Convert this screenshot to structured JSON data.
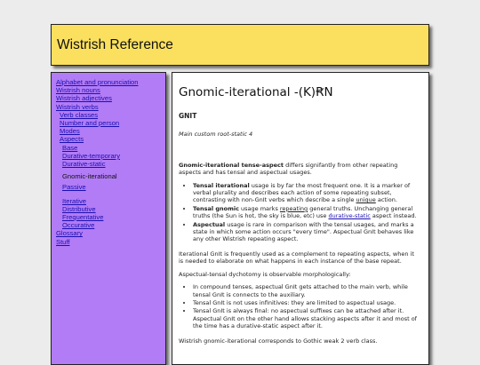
{
  "header": {
    "title": "Wistrish Reference"
  },
  "nav": {
    "alphabet": "Alphabet and pronunciation",
    "nouns": "Wistrish nouns",
    "adjectives": "Wistrish adjectives",
    "verbs": "Wistrish verbs",
    "verb_classes": "Verb classes",
    "number_person": "Number and person",
    "modes": "Modes",
    "aspects": "Aspects",
    "base": "Base",
    "durative_temporary": "Durative-temporary",
    "durative_static": "Durative-static",
    "gnomic_iterational": "Gnomic-iterational",
    "passive": "Passive",
    "iterative": "Iterative",
    "distributive": "Distributive",
    "frequentative": "Frequentative",
    "occurative": "Occurative",
    "glossary": "Glossary",
    "stuff": "Stuff"
  },
  "main": {
    "title": "Gnomic-iterational -(K)ꞦN",
    "word": "GNIT",
    "subtitle": "Main custom root-static 4",
    "intro_bold": "Gnomic-iterational tense-aspect",
    "intro_rest": " differs signifantly from other repeating aspects and has tensal and aspectual usages.",
    "b1_term": "Tensal iterational",
    "b1_a": " usage is by far the most frequent one. It is a marker of verbal plurality and describes each action of some repeating subset, contrasting with non-GnIt verbs which describe a single ",
    "b1_u": "unique",
    "b1_b": " action.",
    "b2_term": "Tensal gnomic",
    "b2_a": " usage marks ",
    "b2_u": "repeating",
    "b2_b": " general truths. Unchanging general truths (the Sun is hot, the sky is blue, etc) use ",
    "b2_link": "durative-static",
    "b2_c": " aspect instead.",
    "b3_term": "Aspectual",
    "b3_rest": " usage is rare in comparison with the tensal usages, and marks a state in which some action occurs \"every time\". Aspectual GnIt behaves like any other Wistrish repeating aspect.",
    "p2": "Iterational GnIt is frequently used as a complement to repeating aspects, when it is needed to elaborate on what happens in each instance of the base repeat.",
    "p3": "Aspectual-tensal dychotomy is observable morphologically:",
    "c1": "In compound tenses, aspectual GnIt gets attached to the main verb, while tensal GnIt is connects to the auxiliary.",
    "c2": "Tensal GnIt is not uses infinitives: they are limited to aspectual usage.",
    "c3": "Tensal GnIt is always final: no aspectual suffixes can be attached after it. Aspectual GnIt on the other hand allows stacking aspects after it and most of the time has a durative-static aspect after it.",
    "p4": "Wistrish gnomic-iterational corresponds to Gothic weak 2 verb class."
  }
}
